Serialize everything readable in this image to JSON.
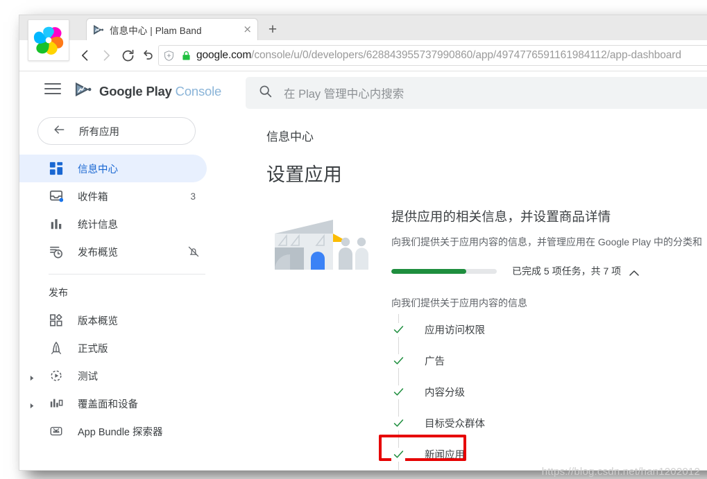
{
  "browser": {
    "logo_icon": "pinwheel-browser-logo",
    "tab": {
      "title": "信息中心 | Plam Band",
      "favicon_icon": "play-console-favicon",
      "close_icon": "×"
    },
    "new_tab_icon": "+",
    "nav": {
      "back_icon": "‹",
      "forward_icon": "›",
      "reload_icon": "reload-icon",
      "undo_icon": "undo-icon"
    },
    "address": {
      "shield_icon": "shield-plus-icon",
      "lock_icon": "green-lock-icon",
      "host": "google.com",
      "path": "/console/u/0/developers/628843955737990860/app/4974776591161984112/app-dashboard"
    }
  },
  "console_header": {
    "menu_icon": "hamburger-menu-icon",
    "brand_primary": "Google Play",
    "brand_secondary": "Console",
    "brand_logo_icon": "play-console-logo-icon",
    "search": {
      "icon": "search-icon",
      "placeholder": "在 Play 管理中心内搜索"
    }
  },
  "sidebar": {
    "all_apps": {
      "label": "所有应用",
      "icon": "arrow-left-icon"
    },
    "primary_items": [
      {
        "label": "信息中心",
        "icon": "dashboard-icon",
        "active": true,
        "badge": "",
        "trailing_icon": ""
      },
      {
        "label": "收件箱",
        "icon": "inbox-icon",
        "active": false,
        "badge": "3",
        "trailing_icon": ""
      },
      {
        "label": "统计信息",
        "icon": "statistics-bar-chart-icon",
        "active": false,
        "badge": "",
        "trailing_icon": ""
      },
      {
        "label": "发布概览",
        "icon": "publishing-overview-clock-icon",
        "active": false,
        "badge": "",
        "trailing_icon": "notifications-off-icon"
      }
    ],
    "section_title": "发布",
    "release_items": [
      {
        "label": "版本概览",
        "icon": "release-overview-icon",
        "expandable": false
      },
      {
        "label": "正式版",
        "icon": "production-rocket-icon",
        "expandable": false
      },
      {
        "label": "测试",
        "icon": "testing-play-circle-icon",
        "expandable": true
      },
      {
        "label": "覆盖面和设备",
        "icon": "reach-devices-chart-icon",
        "expandable": true
      },
      {
        "label": "App Bundle 探索器",
        "icon": "android-bundle-explorer-icon",
        "expandable": false
      }
    ]
  },
  "main": {
    "breadcrumb": "信息中心",
    "page_title": "设置应用",
    "setup_card": {
      "illustration_icon": "building-and-people-illustration",
      "heading": "提供应用的相关信息，并设置商品详情",
      "description": "向我们提供关于应用内容的信息，并管理应用在 Google Play 中的分类和",
      "progress": {
        "completed": 5,
        "total": 7,
        "percent": 71,
        "label": "已完成 5 项任务，共 7 项",
        "fill_color": "#1e8e3e",
        "track_color": "#e5e7e9",
        "collapse_icon": "chevron-up-icon"
      },
      "task_group_title": "向我们提供关于应用内容的信息",
      "tasks": [
        {
          "label": "应用访问权限",
          "done": true,
          "highlighted": false
        },
        {
          "label": "广告",
          "done": true,
          "highlighted": false
        },
        {
          "label": "内容分级",
          "done": true,
          "highlighted": false
        },
        {
          "label": "目标受众群体",
          "done": true,
          "highlighted": false
        },
        {
          "label": "新闻应用",
          "done": true,
          "highlighted": true
        }
      ],
      "check_color": "#1e8e3e",
      "highlight_color": "#e60000"
    }
  },
  "watermark": "https://blog.csdn.net/han1202012"
}
